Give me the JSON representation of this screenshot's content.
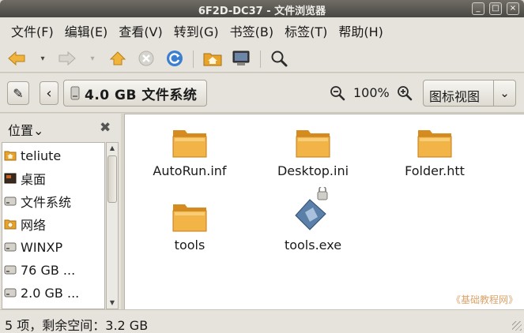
{
  "window": {
    "title": "6F2D-DC37 - 文件浏览器",
    "buttons": [
      "_",
      "□",
      "×"
    ]
  },
  "menubar": [
    {
      "label": "文件(F)"
    },
    {
      "label": "编辑(E)"
    },
    {
      "label": "查看(V)"
    },
    {
      "label": "转到(G)"
    },
    {
      "label": "书签(B)"
    },
    {
      "label": "标签(T)"
    },
    {
      "label": "帮助(H)"
    }
  ],
  "toolbar": {
    "icons": [
      "back-arrow-icon",
      "forward-arrow-icon",
      "home-icon",
      "stop-icon",
      "reload-icon",
      "home-folder-icon",
      "computer-icon",
      "search-icon"
    ],
    "dropdown_glyph": "▾"
  },
  "location": {
    "edit_glyph": "✎",
    "prev_glyph": "‹",
    "crumb": "4.0 GB 文件系统",
    "zoom_level": "100%",
    "view_mode": "图标视图",
    "view_arrow": "⌄"
  },
  "sidebar": {
    "title": "位置",
    "title_arrow": "⌄",
    "close_glyph": "✖",
    "scroll_up": "▲",
    "scroll_down": "▼",
    "items": [
      {
        "label": "teliute",
        "icon": "home-folder-icon"
      },
      {
        "label": "桌面",
        "icon": "desktop-icon"
      },
      {
        "label": "文件系统",
        "icon": "drive-icon"
      },
      {
        "label": "网络",
        "icon": "network-icon"
      },
      {
        "label": "WINXP",
        "icon": "drive-icon"
      },
      {
        "label": "76 GB ...",
        "icon": "drive-icon"
      },
      {
        "label": "2.0 GB ...",
        "icon": "drive-icon"
      }
    ]
  },
  "files": [
    {
      "name": "AutoRun.inf",
      "icon": "folder-icon"
    },
    {
      "name": "Desktop.ini",
      "icon": "folder-icon"
    },
    {
      "name": "Folder.htt",
      "icon": "folder-icon"
    },
    {
      "name": "tools",
      "icon": "folder-icon"
    },
    {
      "name": "tools.exe",
      "icon": "executable-icon",
      "locked": true
    }
  ],
  "watermark": "《基础教程网》",
  "status": "5 项，剩余空间：3.2 GB",
  "colors": {
    "folder": "#f2b347",
    "folder_dark": "#d68b1e",
    "accent_home": "#e8a32a",
    "reload_blue": "#3a7fd0"
  }
}
